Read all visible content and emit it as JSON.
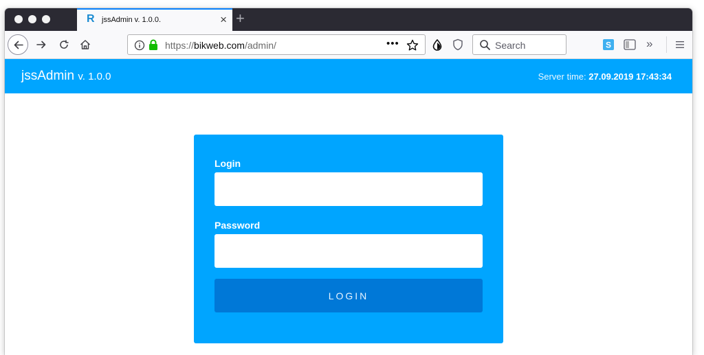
{
  "browser": {
    "tab": {
      "favicon": "R",
      "title": "jssAdmin v. 1.0.0."
    },
    "url": {
      "prefix": "https://",
      "host": "bikweb.com",
      "path": "/admin/"
    },
    "search": {
      "placeholder": "Search"
    },
    "accent_color": "#0a84ff"
  },
  "app": {
    "name": "jssAdmin",
    "version": "v. 1.0.0",
    "server_time_label": "Server time:",
    "server_time_value": "27.09.2019 17:43:34",
    "brand_color": "#00a5ff"
  },
  "login_form": {
    "login_label": "Login",
    "login_value": "",
    "password_label": "Password",
    "password_value": "",
    "submit_label": "LOGIN",
    "button_color": "#0078d7"
  }
}
